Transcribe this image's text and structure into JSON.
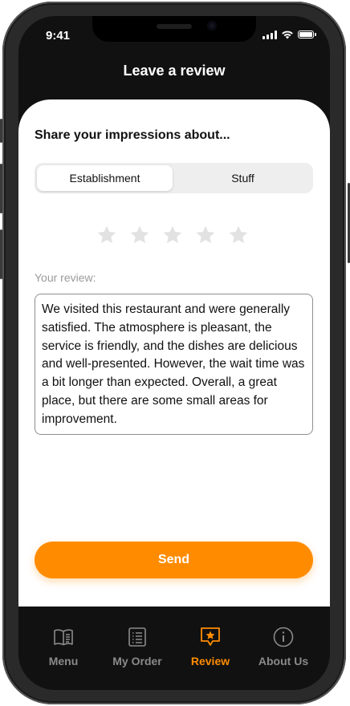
{
  "status_bar": {
    "time": "9:41"
  },
  "header": {
    "title": "Leave a review"
  },
  "form": {
    "prompt": "Share your impressions about...",
    "segments": [
      "Establishment",
      "Stuff"
    ],
    "selected_segment": "Establishment",
    "rating": 0,
    "rating_max": 5,
    "review_label": "Your review:",
    "review_text": "We visited this restaurant and were generally satisfied. The atmosphere is pleasant, the service is friendly, and the dishes are delicious and well-presented. However, the wait time was a bit longer than expected. Overall, a great place, but there are some small areas for improvement.",
    "send_label": "Send"
  },
  "tabbar": {
    "items": [
      {
        "label": "Menu",
        "icon": "book-icon"
      },
      {
        "label": "My Order",
        "icon": "list-icon"
      },
      {
        "label": "Review",
        "icon": "star-chat-icon"
      },
      {
        "label": "About Us",
        "icon": "info-icon"
      }
    ],
    "active": "Review"
  },
  "colors": {
    "accent": "#FF8C00",
    "background_dark": "#111111",
    "inactive_tab": "#8A8A8A",
    "star_empty": "#E2E2E2"
  }
}
